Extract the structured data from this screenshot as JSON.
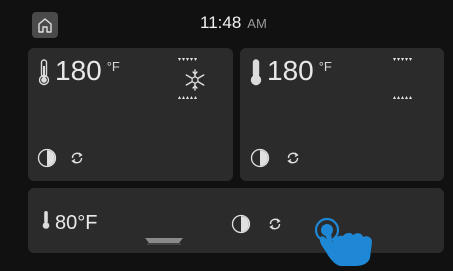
{
  "header": {
    "time": "11:48",
    "ampm": "AM",
    "home_icon": "home-icon"
  },
  "zones": [
    {
      "temperature": "180",
      "unit": "°F",
      "mode_icon": "snowflake-fan-icon",
      "has_fan": true
    },
    {
      "temperature": "180",
      "unit": "°F",
      "has_fan": false
    },
    {
      "temperature": "80°F",
      "unit": "",
      "drawer_icon": "warming-drawer-icon"
    }
  ],
  "colors": {
    "panel": "#2b2b2b",
    "background": "#111111",
    "accent": "#1e88d6",
    "text": "#e6e6e6"
  },
  "overlay": {
    "icon": "tap-hand-icon"
  }
}
